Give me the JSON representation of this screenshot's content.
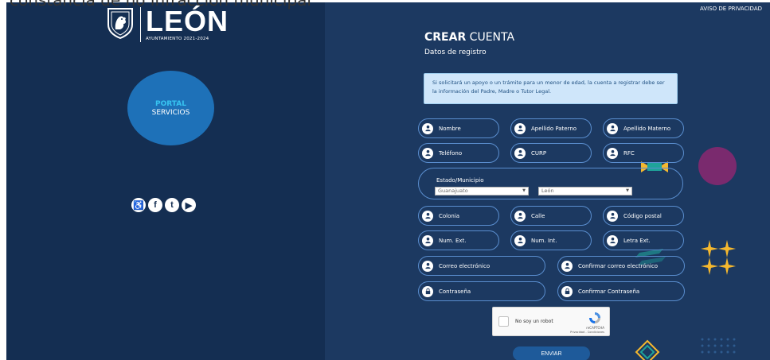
{
  "page": {
    "cutoff_heading": "constancia de no infracción municipal"
  },
  "left": {
    "logo": {
      "name": "LEÓN",
      "subtitle": "AYUNTAMIENTO 2021-2024",
      "icon": "city-shield-icon"
    },
    "portal": {
      "title": "PORTAL",
      "subtitle": "SERVICIOS"
    },
    "social": [
      {
        "name": "accessibility-icon",
        "glyph": "♿"
      },
      {
        "name": "facebook-icon",
        "glyph": "f"
      },
      {
        "name": "twitter-icon",
        "glyph": "t"
      },
      {
        "name": "youtube-icon",
        "glyph": "▶"
      }
    ]
  },
  "right": {
    "privacy_link": "AVISO DE PRIVACIDAD",
    "title_bold": "CREAR",
    "title_rest": " CUENTA",
    "subtitle": "Datos de registro",
    "notice": "Si solicitará un apoyo o un trámite para un menor de edad, la cuenta a registrar debe ser la información del Padre, Madre o Tutor Legal.",
    "fields": {
      "nombre": "Nombre",
      "apellido_paterno": "Apellido Paterno",
      "apellido_materno": "Apellido Materno",
      "telefono": "Teléfono",
      "curp": "CURP",
      "rfc": "RFC",
      "colonia": "Colonia",
      "calle": "Calle",
      "codigo_postal": "Código postal",
      "num_ext": "Num. Ext.",
      "num_int": "Num. Int.",
      "letra_ext": "Letra Ext.",
      "correo": "Correo electrónico",
      "confirmar_correo": "Confirmar correo electrónico",
      "contrasena": "Contraseña",
      "confirmar_contrasena": "Confirmar Contraseña"
    },
    "estado_municipio": {
      "label": "Estado/Municipio",
      "estado_value": "Guanajuato",
      "municipio_value": "León"
    },
    "captcha": {
      "label": "No soy un robot",
      "brand": "reCAPTCHA",
      "links": "Privacidad - Condiciones"
    },
    "submit": "ENVIAR"
  },
  "colors": {
    "left_bg": "#142e52",
    "right_bg": "#1c3961",
    "pill_border": "#5a8ecf",
    "portal_circle": "#1e71b8",
    "notice_bg": "#cfe6fa",
    "accent_cyan": "#37c3f0",
    "deco_yellow": "#f5b82e",
    "deco_purple": "#7a2a6e"
  }
}
